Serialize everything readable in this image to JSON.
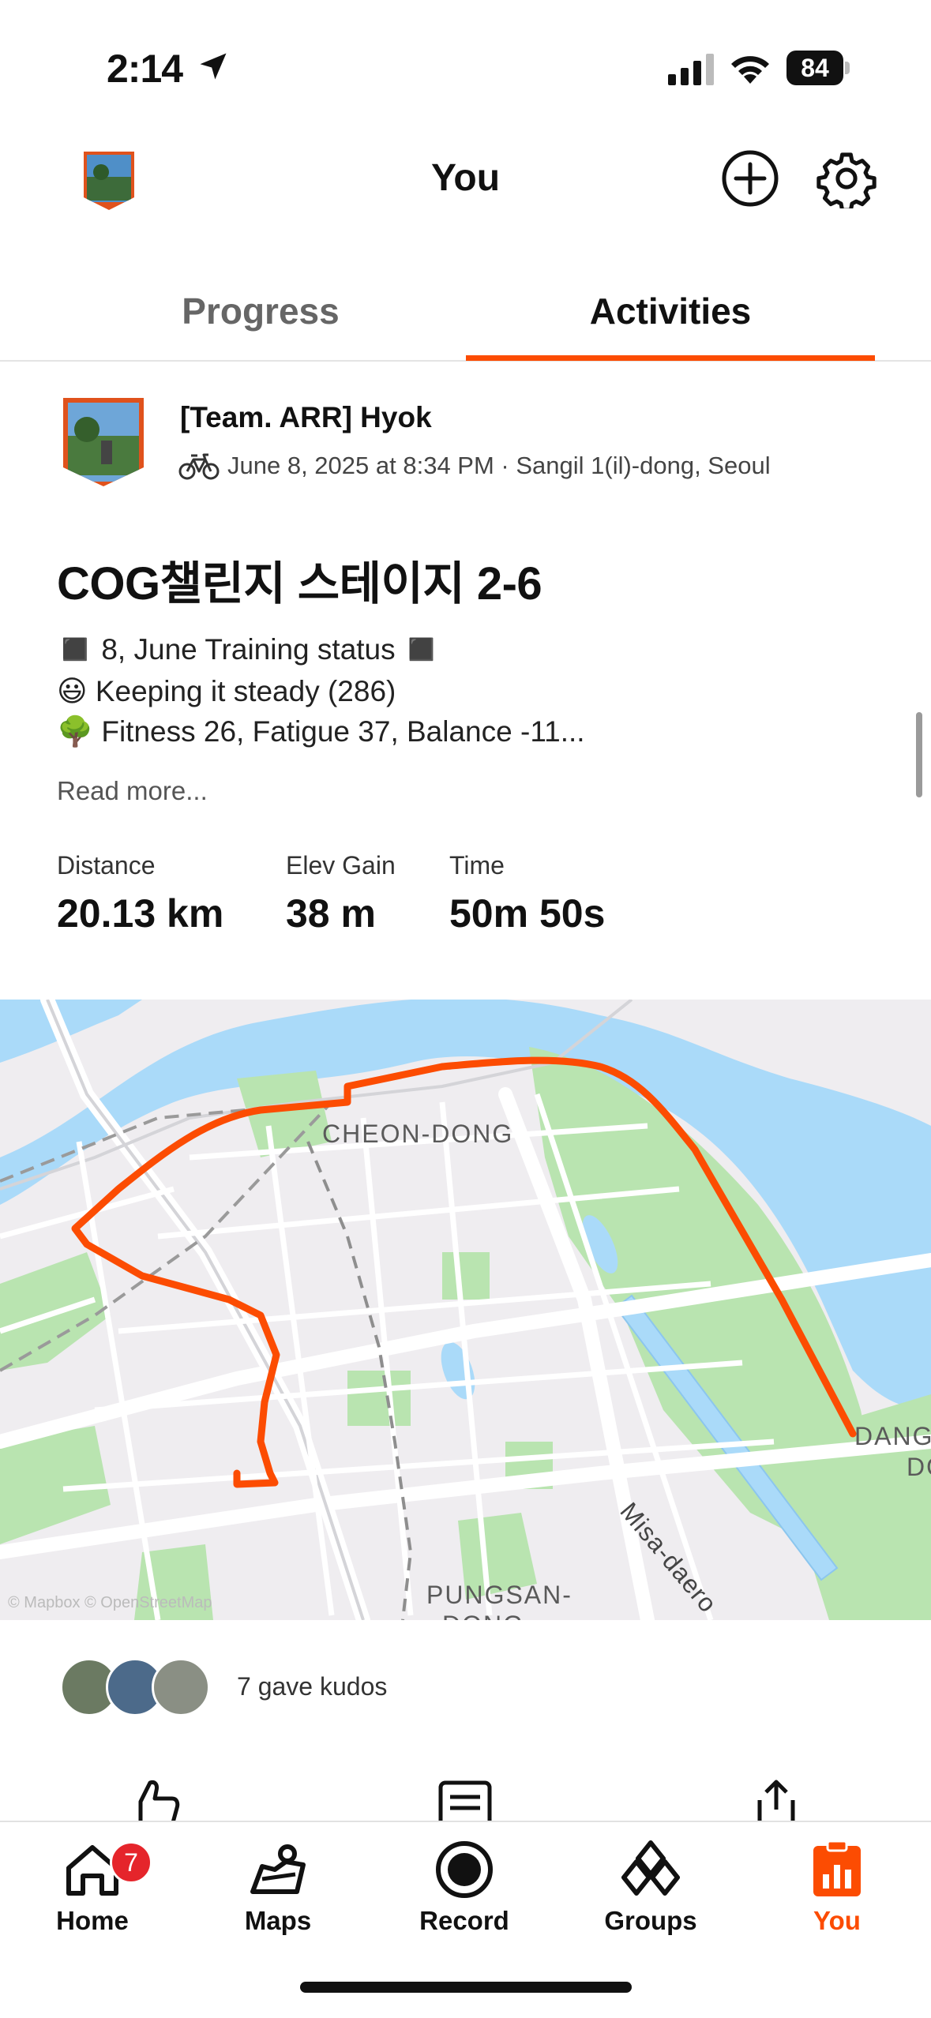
{
  "status_bar": {
    "time": "2:14",
    "battery": "84"
  },
  "header": {
    "title": "You"
  },
  "tabs": [
    {
      "label": "Progress",
      "active": false
    },
    {
      "label": "Activities",
      "active": true
    }
  ],
  "activity": {
    "athlete_name": "[Team. ARR] Hyok",
    "meta": "June 8, 2025 at 8:34 PM · Sangil 1(il)-dong, Seoul",
    "title": "COG챌린지 스테이지 2-6",
    "description_lines": [
      "◼️ 8, June Training status ◼️",
      "😃 Keeping it steady (286)",
      "🌳 Fitness 26, Fatigue 37, Balance -11..."
    ],
    "read_more": "Read more...",
    "stats": [
      {
        "label": "Distance",
        "value": "20.13 km"
      },
      {
        "label": "Elev Gain",
        "value": "38 m"
      },
      {
        "label": "Time",
        "value": "50m 50s"
      }
    ]
  },
  "map": {
    "labels": [
      "CHEON-DONG",
      "PUNGSAN-",
      "DONG",
      "Misa-daero",
      "DANG",
      "DO"
    ],
    "attribution": "© Mapbox © OpenStreetMap",
    "route_color": "#fc4c02",
    "water_color": "#aadaf9",
    "park_color": "#b9e4b0"
  },
  "kudos": {
    "text": "7 gave kudos"
  },
  "bottom_nav": [
    {
      "label": "Home",
      "icon": "home-icon",
      "badge": "7"
    },
    {
      "label": "Maps",
      "icon": "map-icon"
    },
    {
      "label": "Record",
      "icon": "record-icon"
    },
    {
      "label": "Groups",
      "icon": "groups-icon"
    },
    {
      "label": "You",
      "icon": "you-icon",
      "active": true
    }
  ],
  "colors": {
    "accent": "#fc4c02",
    "badge": "#e5252b"
  }
}
